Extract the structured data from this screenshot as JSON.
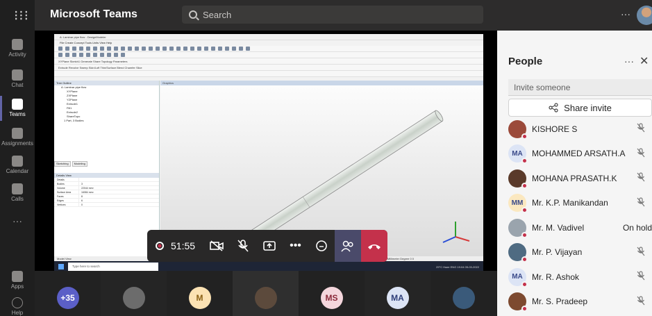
{
  "app": {
    "title": "Microsoft Teams",
    "search_placeholder": "Search",
    "more": "···"
  },
  "rail": [
    {
      "label": "Activity"
    },
    {
      "label": "Chat"
    },
    {
      "label": "Teams"
    },
    {
      "label": "Assignments"
    },
    {
      "label": "Calendar"
    },
    {
      "label": "Calls"
    },
    {
      "label": "···"
    },
    {
      "label": "Apps"
    },
    {
      "label": "Help"
    }
  ],
  "shared_screen": {
    "window_title": "A: Laminar pipe flow - DesignModeler",
    "menu": "File  Create  Concept  Tools  Units  View  Help",
    "toolbar_row": "XYPlane   Sketch1   Generate   Share Topology   Parameters",
    "toolbar_row2": "Extrude  Revolve  Sweep  Skin/Loft  Thin/Surface  Blend  Chamfer  Slice",
    "tree_header": "Tree Outline",
    "tree_items": [
      "A: Laminar pipe flow",
      "XYPlane",
      "ZXPlane",
      "YZPlane",
      "Extrude1",
      "Fill1",
      "Extrude2",
      "ShareTopo",
      "1 Part, 3 Bodies"
    ],
    "tree_tabs": [
      "Sketching",
      "Modeling"
    ],
    "details_header": "Details View",
    "details": [
      {
        "k": "Details",
        "v": ""
      },
      {
        "k": "Bodies",
        "v": "3"
      },
      {
        "k": "Volume",
        "v": "22044 mm³"
      },
      {
        "k": "Surface Area",
        "v": "16084 mm²"
      },
      {
        "k": "Faces",
        "v": "8"
      },
      {
        "k": "Edges",
        "v": "6"
      },
      {
        "k": "Vertices",
        "v": "0"
      }
    ],
    "graphics_header": "Graphics",
    "status_left": "Model View",
    "status_mid": "No Selection",
    "status_right": "Millimeter  Degree  0  0",
    "taskbar_search": "Type here to search",
    "taskbar_tray": "29°C Haze  ENG  19:04  05-03-2022"
  },
  "call_controls": {
    "duration": "51:55",
    "icons": [
      "video-off-icon",
      "mic-off-icon",
      "share-screen-icon",
      "more-icon",
      "chat-icon",
      "people-icon",
      "hangup-icon"
    ]
  },
  "people_panel": {
    "title": "People",
    "more": "···",
    "close": "✕",
    "invite_placeholder": "Invite someone",
    "share_invite": "Share invite",
    "participants": [
      {
        "name": "KISHORE S",
        "initials": "",
        "avatar_bg": "#9b4a3a",
        "status": ""
      },
      {
        "name": "MOHAMMED ARSATH.A",
        "initials": "MA",
        "avatar_bg": "#dce4f5",
        "status": ""
      },
      {
        "name": "MOHANA PRASATH.K",
        "initials": "",
        "avatar_bg": "#5a3a2a",
        "status": ""
      },
      {
        "name": "Mr. K.P. Manikandan",
        "initials": "MM",
        "avatar_bg": "#fbe8c0",
        "status": ""
      },
      {
        "name": "Mr. M. Vadivel",
        "initials": "",
        "avatar_bg": "#9aa4ad",
        "status": "On hold"
      },
      {
        "name": "Mr. P. Vijayan",
        "initials": "",
        "avatar_bg": "#4f6b82",
        "status": ""
      },
      {
        "name": "Mr. R. Ashok",
        "initials": "MA",
        "avatar_bg": "#dce4f5",
        "status": ""
      },
      {
        "name": "Mr. S. Pradeep",
        "initials": "",
        "avatar_bg": "#7d4a30",
        "status": ""
      }
    ]
  },
  "video_strip": [
    {
      "label": "+35",
      "bg": "#5b5fc7",
      "color": "#ffffff"
    },
    {
      "label": "",
      "bg": "#6c6c6c",
      "color": "#ffffff"
    },
    {
      "label": "M",
      "bg": "#fbe2b3",
      "color": "#8a6116"
    },
    {
      "label": "",
      "bg": "#5c4a3c",
      "color": "#ffffff"
    },
    {
      "label": "MS",
      "bg": "#f4d6dc",
      "color": "#8b2a3a"
    },
    {
      "label": "MA",
      "bg": "#dce4f5",
      "color": "#30407a"
    },
    {
      "label": "",
      "bg": "#3a5a7a",
      "color": "#ffffff"
    }
  ]
}
